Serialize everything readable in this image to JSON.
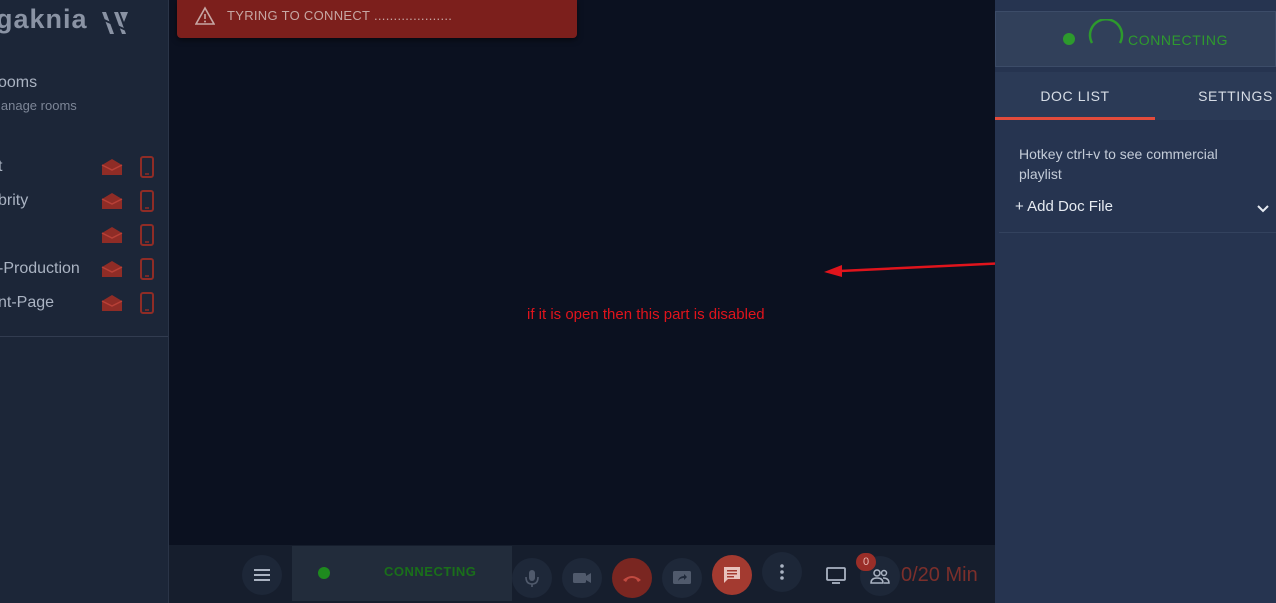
{
  "sidebar": {
    "logo_text": "gaknia",
    "rooms_title": "ooms",
    "rooms_subtitle": "lanage rooms",
    "rooms": [
      {
        "label": "t"
      },
      {
        "label": "brity"
      },
      {
        "label": ""
      },
      {
        "label": "-Production"
      },
      {
        "label": "nt-Page"
      }
    ]
  },
  "toast": {
    "icon": "warning-icon",
    "message": "TYRING TO CONNECT ...................."
  },
  "annotation": {
    "text": "if it is open then this part is disabled",
    "color": "#e0141c"
  },
  "toolbar": {
    "status_text": "CONNECTING",
    "participants_count": "0",
    "timer": "0/20 Min",
    "buttons": [
      "menu-icon",
      "mic-icon",
      "video-icon",
      "hangup-icon",
      "share-screen-icon",
      "chat-icon",
      "more-vert-icon",
      "monitor-icon",
      "participants-icon"
    ]
  },
  "right_panel": {
    "connection_text": "CONNECTING",
    "tabs": [
      {
        "label": "DOC LIST",
        "active": true
      },
      {
        "label": "SETTINGS",
        "active": false
      }
    ],
    "hotkey_hint": "Hotkey ctrl+v to see commercial playlist",
    "add_doc_label": "+ Add Doc File"
  },
  "colors": {
    "accent": "#e34b3b",
    "status_green": "#2d9a2d",
    "toast_red": "#7c1f1c"
  }
}
